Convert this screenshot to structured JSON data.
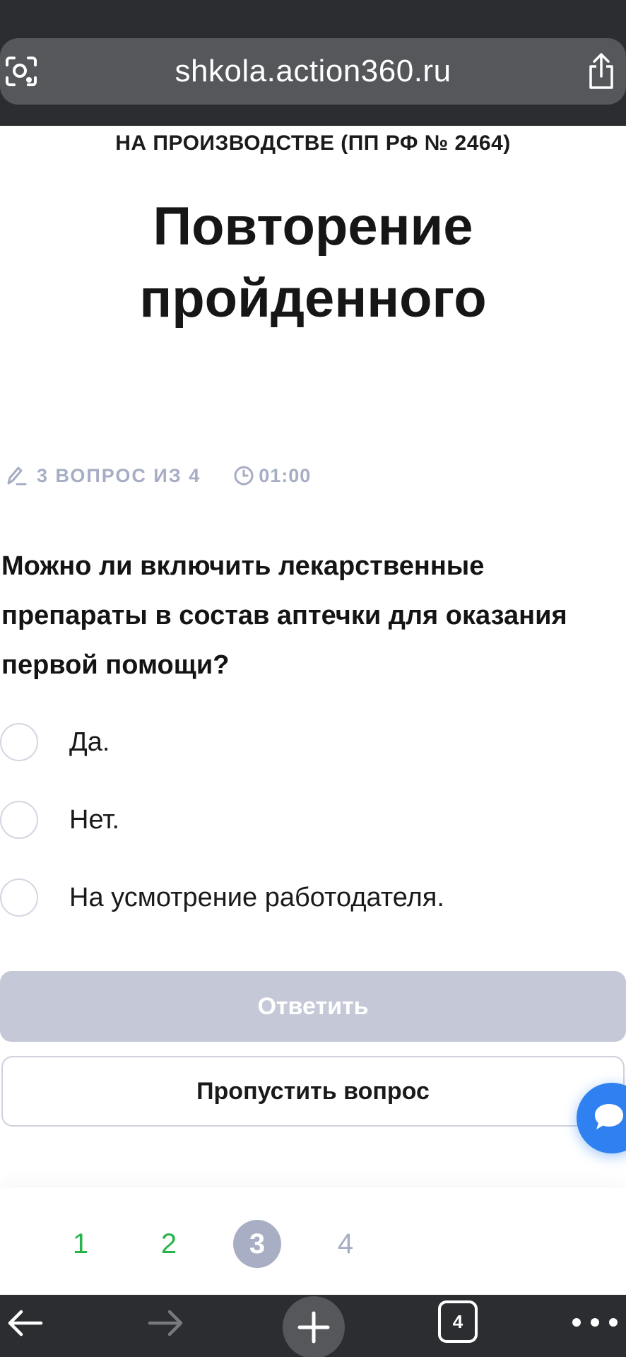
{
  "browser": {
    "url": "shkola.action360.ru",
    "tab_count": "4",
    "icons": [
      "lens-icon",
      "share-icon",
      "back-arrow-icon",
      "forward-arrow-icon",
      "new-tab-icon",
      "tabs-icon",
      "more-icon"
    ]
  },
  "page": {
    "subtitle": "НА ПРОИЗВОДСТВЕ (ПП РФ № 2464)",
    "title_line1": "Повторение",
    "title_line2": "пройденного"
  },
  "quiz": {
    "counter": "3 ВОПРОС ИЗ 4",
    "timer": "01:00",
    "question": "Можно ли включить лекарственные препараты в состав аптечки для оказания первой помощи?",
    "options": [
      {
        "label": "Да.",
        "selected": false
      },
      {
        "label": "Нет.",
        "selected": false
      },
      {
        "label": "На усмотрение работодателя.",
        "selected": false
      }
    ],
    "answer_button": "Ответить",
    "skip_button": "Пропустить вопрос",
    "answer_enabled": false
  },
  "pagination": {
    "pages": [
      {
        "label": "1",
        "state": "done"
      },
      {
        "label": "2",
        "state": "done"
      },
      {
        "label": "3",
        "state": "current"
      },
      {
        "label": "4",
        "state": "todo"
      }
    ]
  },
  "colors": {
    "accent_done": "#27b34a",
    "muted": "#a6adc4",
    "chat_button": "#2f80f0",
    "disabled_button": "#c5c9d7"
  }
}
